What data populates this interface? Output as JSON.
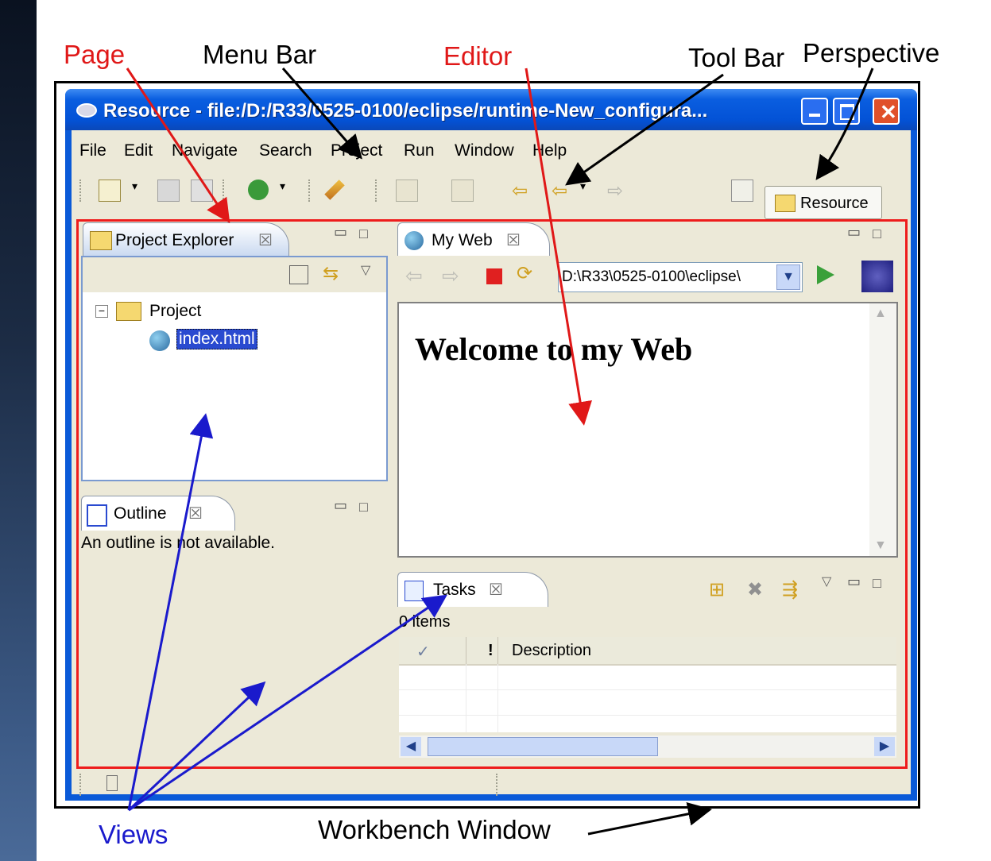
{
  "annotations": {
    "page": "Page",
    "menu_bar": "Menu Bar",
    "editor": "Editor",
    "tool_bar": "Tool Bar",
    "perspective": "Perspective",
    "views": "Views",
    "workbench_window": "Workbench Window"
  },
  "window": {
    "title": "Resource - file:/D:/R33/0525-0100/eclipse/runtime-New_configura..."
  },
  "menu": [
    "File",
    "Edit",
    "Navigate",
    "Search",
    "Project",
    "Run",
    "Window",
    "Help"
  ],
  "perspective": {
    "label": "Resource"
  },
  "project_explorer": {
    "tab_label": "Project Explorer",
    "tree": {
      "project": "Project",
      "file": "index.html"
    }
  },
  "outline": {
    "tab_label": "Outline",
    "message": "An outline is not available."
  },
  "editor": {
    "tab_label": "My Web",
    "url": "D:\\R33\\0525-0100\\eclipse\\",
    "heading": "Welcome to my Web"
  },
  "tasks": {
    "tab_label": "Tasks",
    "count": "0 items",
    "columns": {
      "check": "✓",
      "priority": "!",
      "description": "Description"
    }
  },
  "colors": {
    "annotation_red": "#e01818",
    "annotation_blue": "#1a1acc",
    "title_blue": "#0352d6",
    "page_frame": "#ee1c1c"
  }
}
